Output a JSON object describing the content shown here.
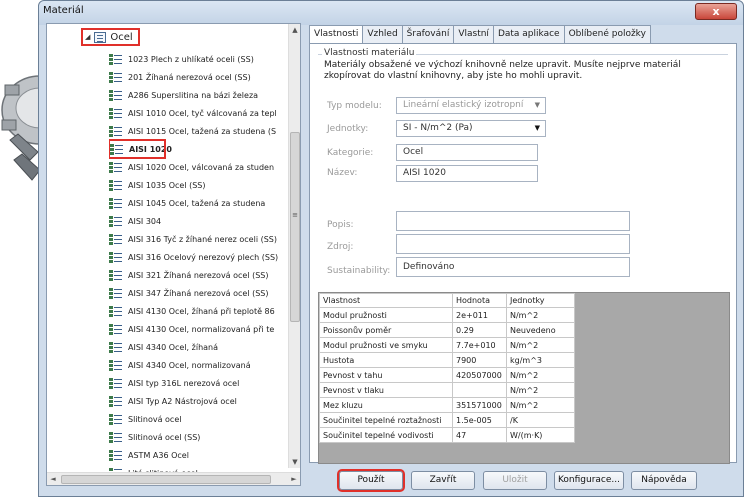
{
  "window": {
    "title": "Materiál",
    "close_glyph": "x"
  },
  "tree": {
    "root_label": "Ocel",
    "items": [
      "1023 Plech z uhlíkaté oceli (SS)",
      "201 Žíhaná nerezová ocel (SS)",
      "A286 Superslitina na bázi železa",
      "AISI 1010 Ocel, tyč válcovaná za tepl",
      "AISI 1015 Ocel, tažená za studena (S",
      "AISI 1020",
      "AISI 1020 Ocel, válcovaná za studen",
      "AISI 1035 Ocel (SS)",
      "AISI 1045 Ocel, tažená za studena",
      "AISI 304",
      "AISI 316 Tyč z žíhané nerez oceli (SS)",
      "AISI 316 Ocelový nerezový plech (SS)",
      "AISI 321 Žíhaná nerezová ocel (SS)",
      "AISI 347 Žíhaná nerezová ocel (SS)",
      "AISI 4130 Ocel, žíhaná při teplotě 86",
      "AISI 4130 Ocel, normalizovaná při te",
      "AISI 4340 Ocel, žíhaná",
      "AISI 4340 Ocel, normalizovaná",
      "AISI typ 316L nerezová ocel",
      "AISI Typ A2 Nástrojová ocel",
      "Slitinová ocel",
      "Slitinová ocel (SS)",
      "ASTM A36 Ocel",
      "Litá slitinová ocel"
    ],
    "selected_index": 5,
    "scroll": {
      "up": "▲",
      "down": "▼",
      "left": "◄",
      "right": "►",
      "grip": "≡"
    }
  },
  "tabs": [
    "Vlastnosti",
    "Vzhled",
    "Šrafování",
    "Vlastní",
    "Data aplikace",
    "Oblíbené položky"
  ],
  "props_section": {
    "title": "Vlastnosti materiálu",
    "info": "Materiály obsažené ve výchozí knihovně nelze upravit. Musíte nejprve materiál zkopírovat do vlastní knihovny, aby jste ho mohli upravit.",
    "model_label": "Typ modelu:",
    "model_value": "Lineární elastický izotropní",
    "units_label": "Jednotky:",
    "units_value": "SI - N/m^2 (Pa)",
    "category_label": "Kategorie:",
    "category_value": "Ocel",
    "name_label": "Název:",
    "name_value": "AISI 1020",
    "desc_label": "Popis:",
    "desc_value": "",
    "source_label": "Zdroj:",
    "source_value": "",
    "sustain_label": "Sustainability:",
    "sustain_value": "Definováno"
  },
  "table": {
    "headers": [
      "Vlastnost",
      "Hodnota",
      "Jednotky"
    ],
    "rows": [
      [
        "Modul pružnosti",
        "2e+011",
        "N/m^2"
      ],
      [
        "Poissonův poměr",
        "0.29",
        "Neuvedeno"
      ],
      [
        "Modul pružnosti ve smyku",
        "7.7e+010",
        "N/m^2"
      ],
      [
        "Hustota",
        "7900",
        "kg/m^3"
      ],
      [
        "Pevnost v tahu",
        "420507000",
        "N/m^2"
      ],
      [
        "Pevnost v tlaku",
        "",
        "N/m^2"
      ],
      [
        "Mez kluzu",
        "351571000",
        "N/m^2"
      ],
      [
        "Součinitel tepelné roztažnosti",
        "1.5e-005",
        "/K"
      ],
      [
        "Součinitel tepelné vodivosti",
        "47",
        "W/(m·K)"
      ]
    ]
  },
  "buttons": {
    "apply": "Použít",
    "close": "Zavřít",
    "save": "Uložit",
    "config": "Konfigurace...",
    "help": "Nápověda"
  }
}
